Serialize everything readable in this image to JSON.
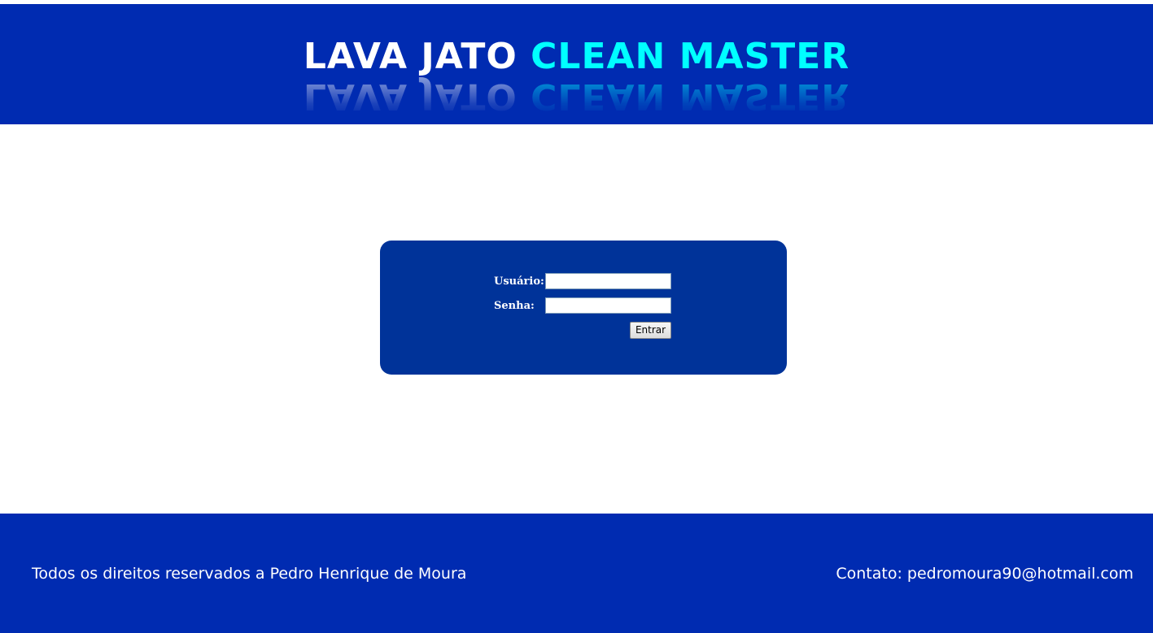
{
  "header": {
    "logo_part1": "LAVA JATO",
    "logo_part2": "CLEAN MASTER",
    "background_color": "#002bb1",
    "logo_accent_color": "#00ffff"
  },
  "login": {
    "user_label": "Usuário:",
    "user_value": "",
    "password_label": "Senha:",
    "password_value": "",
    "submit_label": "Entrar",
    "box_color": "#003399"
  },
  "footer": {
    "copyright": "Todos os direitos reservados a Pedro Henrique de Moura",
    "contact": "Contato: pedromoura90@hotmail.com"
  }
}
